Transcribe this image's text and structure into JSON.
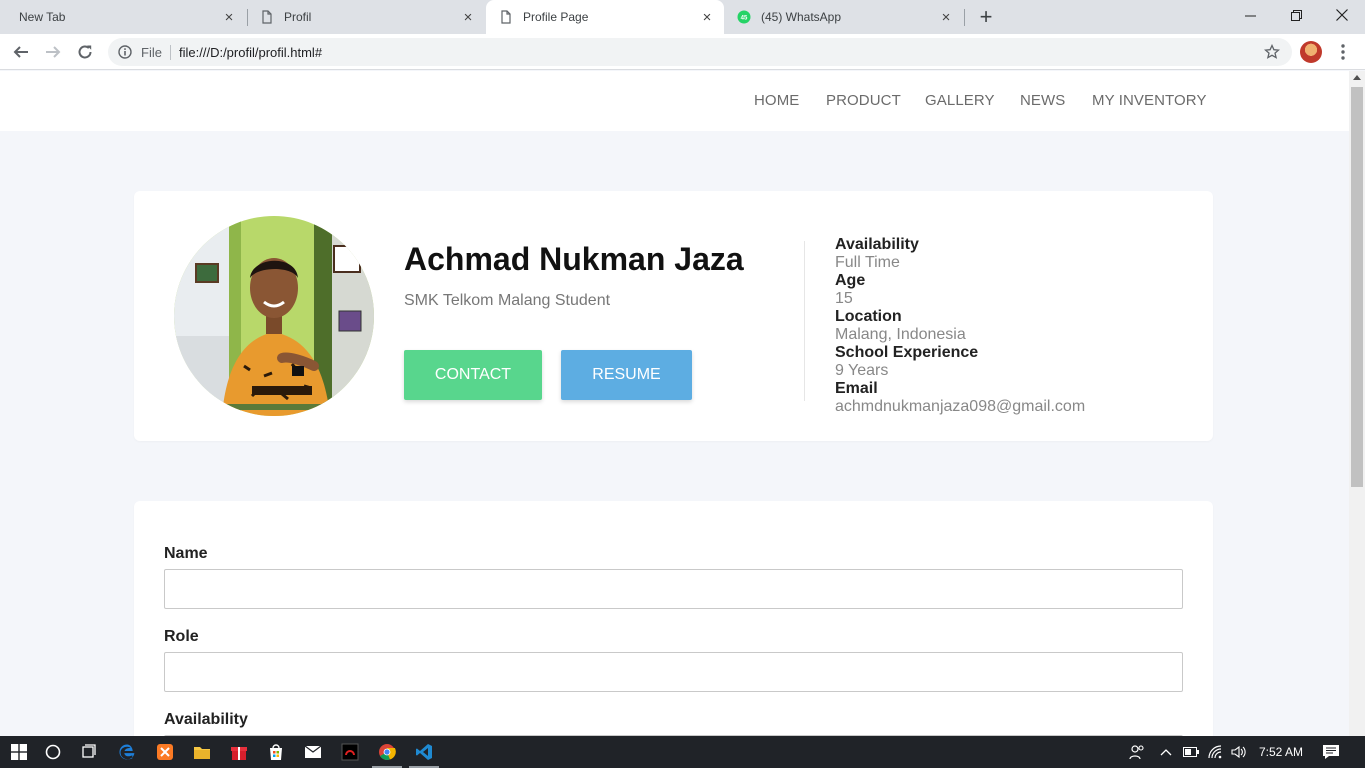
{
  "browser": {
    "tabs": [
      {
        "title": "New Tab",
        "active": false
      },
      {
        "title": "Profil",
        "active": false
      },
      {
        "title": "Profile Page",
        "active": true
      },
      {
        "title": "(45) WhatsApp",
        "active": false
      }
    ],
    "whatsapp_badge": "45",
    "omnibox": {
      "scheme_label": "File",
      "url": "file:///D:/profil/profil.html#"
    },
    "icons": [
      "back-icon",
      "forward-icon",
      "reload-icon",
      "info-icon",
      "star-icon",
      "avatar",
      "kebab-menu-icon",
      "new-tab-icon",
      "minimize-icon",
      "maximize-icon",
      "close-icon"
    ]
  },
  "nav": {
    "items": [
      "HOME",
      "PRODUCT",
      "GALLERY",
      "NEWS",
      "MY INVENTORY"
    ]
  },
  "profile": {
    "name": "Achmad Nukman Jaza",
    "school": "SMK Telkom Malang Student",
    "contact_label": "CONTACT",
    "resume_label": "RESUME",
    "contact_color": "#58d68d",
    "resume_color": "#5dade2",
    "details": [
      {
        "label": "Availability",
        "value": "Full Time"
      },
      {
        "label": "Age",
        "value": "15"
      },
      {
        "label": "Location",
        "value": "Malang, Indonesia"
      },
      {
        "label": "School Experience",
        "value": "9 Years"
      },
      {
        "label": "Email",
        "value": "achmdnukmanjaza098@gmail.com"
      }
    ]
  },
  "form": {
    "fields": [
      {
        "label": "Name",
        "value": ""
      },
      {
        "label": "Role",
        "value": ""
      },
      {
        "label": "Availability",
        "value": ""
      }
    ]
  },
  "taskbar": {
    "clock": "7:52 AM",
    "pinned": [
      "windows-start-icon",
      "cortana-icon",
      "task-view-icon",
      "edge-icon",
      "xampp-icon",
      "file-explorer-icon",
      "gift-icon",
      "store-icon",
      "mail-icon",
      "app-icon",
      "chrome-icon",
      "vscode-icon"
    ]
  }
}
